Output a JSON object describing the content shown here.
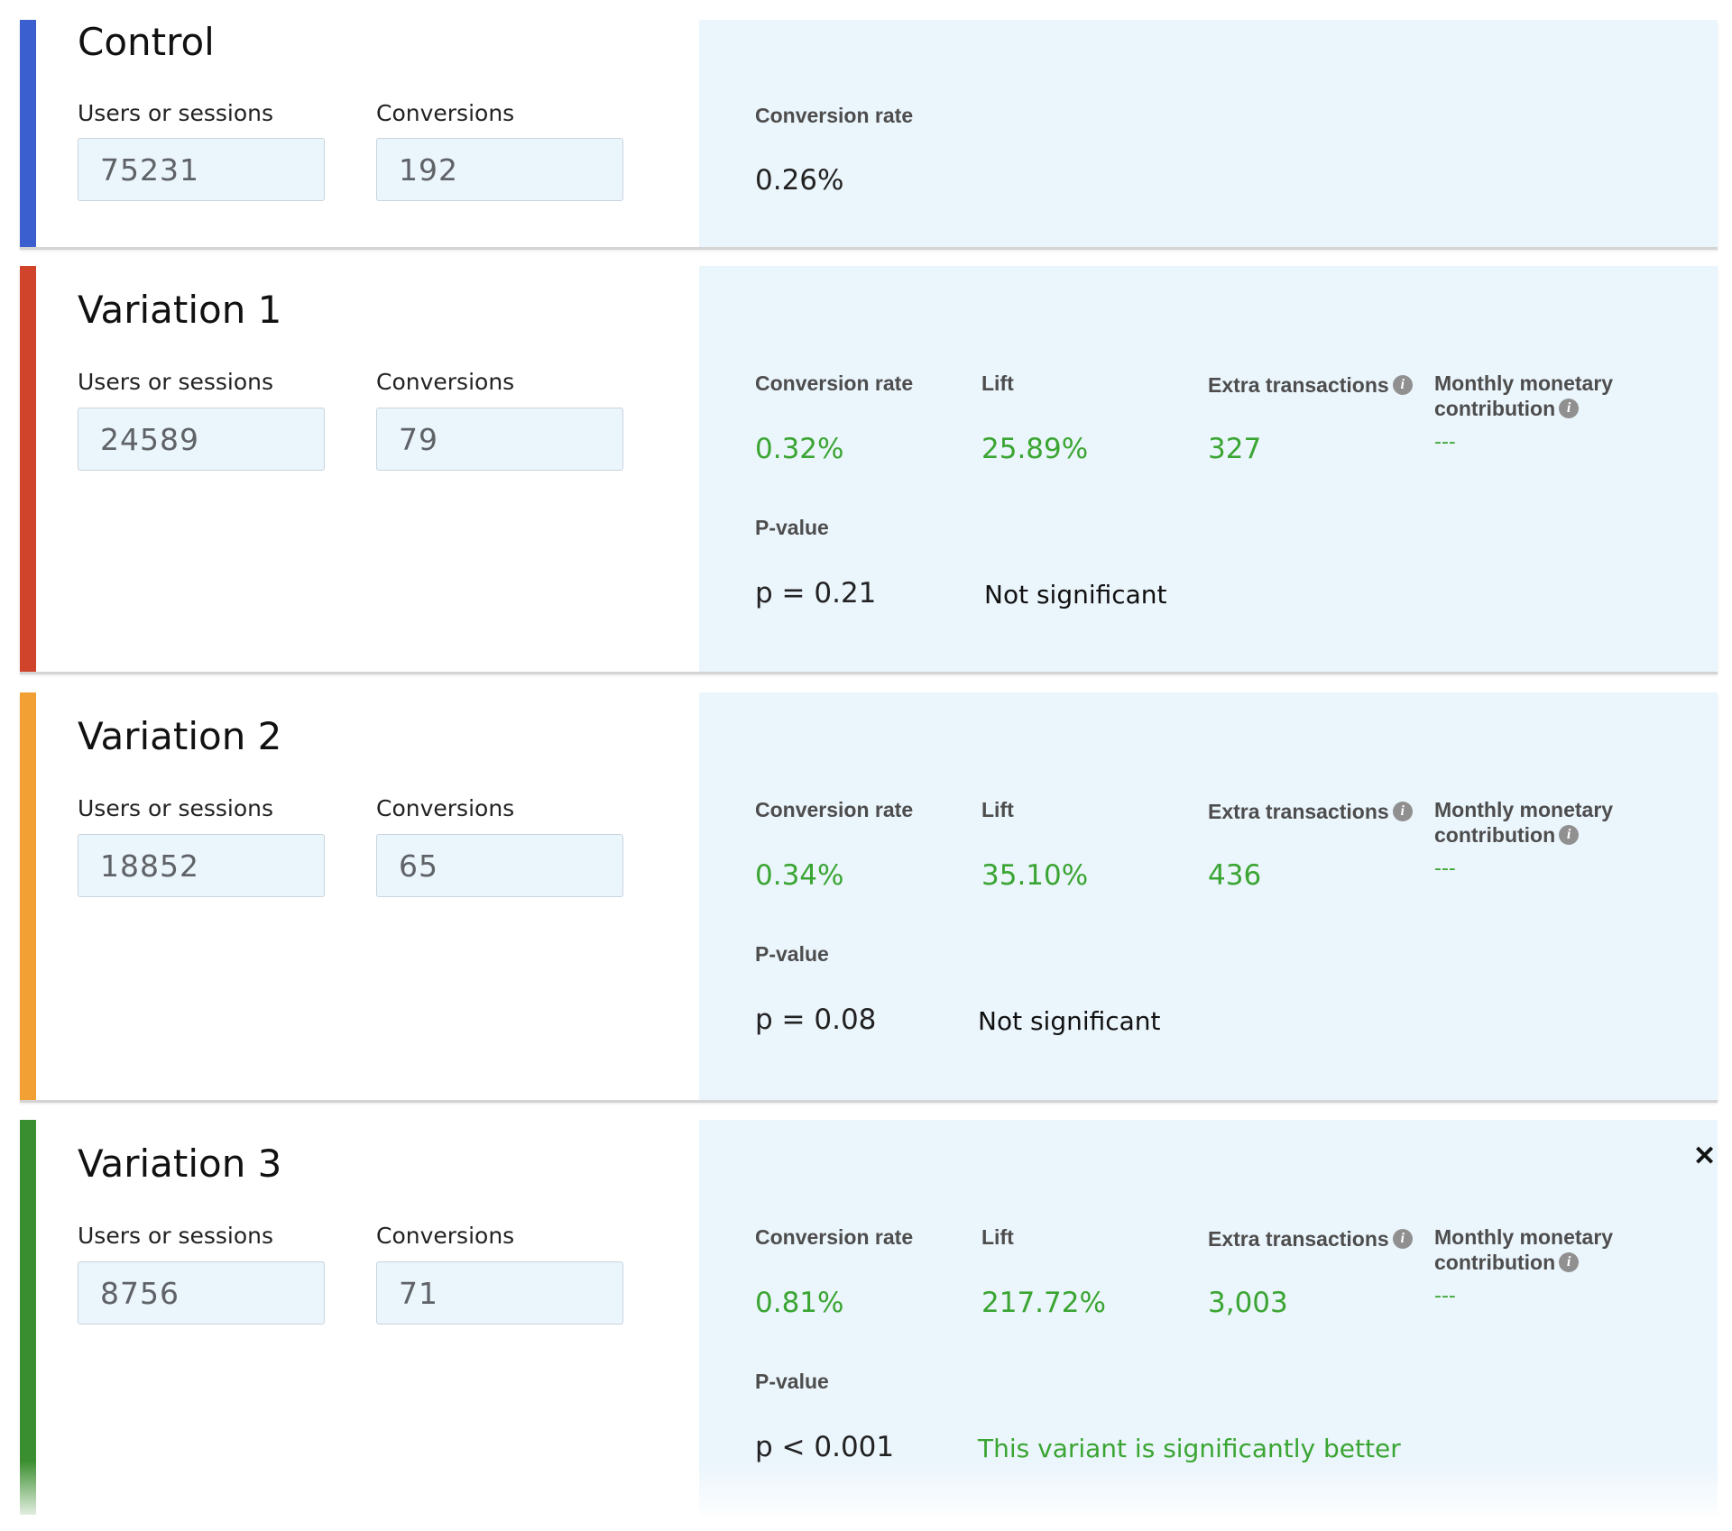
{
  "labels": {
    "users": "Users or sessions",
    "conversions": "Conversions",
    "conversion_rate": "Conversion rate",
    "lift": "Lift",
    "extra_transactions": "Extra transactions",
    "monthly_monetary": "Monthly monetary contribution",
    "p_value": "P-value",
    "info_glyph": "i"
  },
  "colors": {
    "control": "#3b5fcf",
    "variation_1": "#d0442c",
    "variation_2": "#f2a033",
    "variation_3": "#3b8e2f",
    "positive": "#3aa532",
    "panel_bg": "#ebf5fc"
  },
  "control": {
    "title": "Control",
    "users": "75231",
    "conversions": "192",
    "conversion_rate": "0.26%"
  },
  "variations": [
    {
      "title": "Variation 1",
      "users": "24589",
      "conversions": "79",
      "conversion_rate": "0.32%",
      "lift": "25.89%",
      "extra_transactions": "327",
      "monthly_monetary": "---",
      "p_value": "p = 0.21",
      "significance": "Not significant"
    },
    {
      "title": "Variation 2",
      "users": "18852",
      "conversions": "65",
      "conversion_rate": "0.34%",
      "lift": "35.10%",
      "extra_transactions": "436",
      "monthly_monetary": "---",
      "p_value": "p = 0.08",
      "significance": "Not significant"
    },
    {
      "title": "Variation 3",
      "users": "8756",
      "conversions": "71",
      "conversion_rate": "0.81%",
      "lift": "217.72%",
      "extra_transactions": "3,003",
      "monthly_monetary": "---",
      "p_value": "p < 0.001",
      "significance": "This variant is significantly better",
      "close_glyph": "✕"
    }
  ]
}
